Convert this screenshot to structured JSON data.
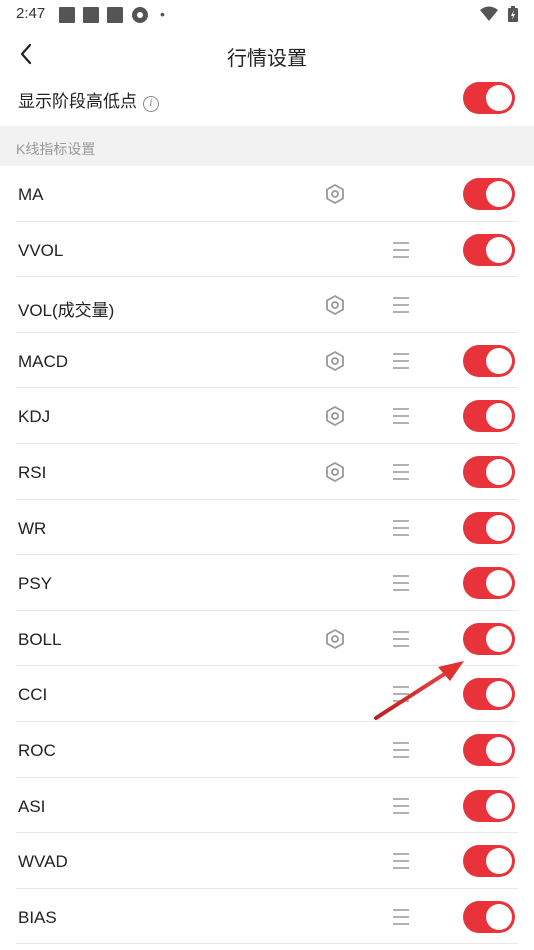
{
  "status": {
    "time": "2:47",
    "dot": "•"
  },
  "header": {
    "title": "行情设置"
  },
  "top_setting": {
    "label": "显示阶段高低点",
    "info": "i",
    "enabled": true
  },
  "section": {
    "title": "K线指标设置"
  },
  "indicators": [
    {
      "name": "MA",
      "gear": true,
      "menu": false,
      "toggle": true
    },
    {
      "name": "VVOL",
      "gear": false,
      "menu": true,
      "toggle": true
    },
    {
      "name": "VOL(成交量)",
      "gear": true,
      "menu": true,
      "toggle": false
    },
    {
      "name": "MACD",
      "gear": true,
      "menu": true,
      "toggle": true
    },
    {
      "name": "KDJ",
      "gear": true,
      "menu": true,
      "toggle": true
    },
    {
      "name": "RSI",
      "gear": true,
      "menu": true,
      "toggle": true
    },
    {
      "name": "WR",
      "gear": false,
      "menu": true,
      "toggle": true
    },
    {
      "name": "PSY",
      "gear": false,
      "menu": true,
      "toggle": true
    },
    {
      "name": "BOLL",
      "gear": true,
      "menu": true,
      "toggle": true
    },
    {
      "name": "CCI",
      "gear": false,
      "menu": true,
      "toggle": true
    },
    {
      "name": "ROC",
      "gear": false,
      "menu": true,
      "toggle": true
    },
    {
      "name": "ASI",
      "gear": false,
      "menu": true,
      "toggle": true
    },
    {
      "name": "WVAD",
      "gear": false,
      "menu": true,
      "toggle": true
    },
    {
      "name": "BIAS",
      "gear": false,
      "menu": true,
      "toggle": true
    }
  ],
  "colors": {
    "accent": "#e8333b",
    "annotation_arrow": "#d42a2a",
    "section_bg": "#f2f2f2"
  },
  "icons": {
    "back": "chevron-left-icon",
    "gear": "hexagon-gear-icon",
    "menu": "hamburger-menu-icon"
  }
}
